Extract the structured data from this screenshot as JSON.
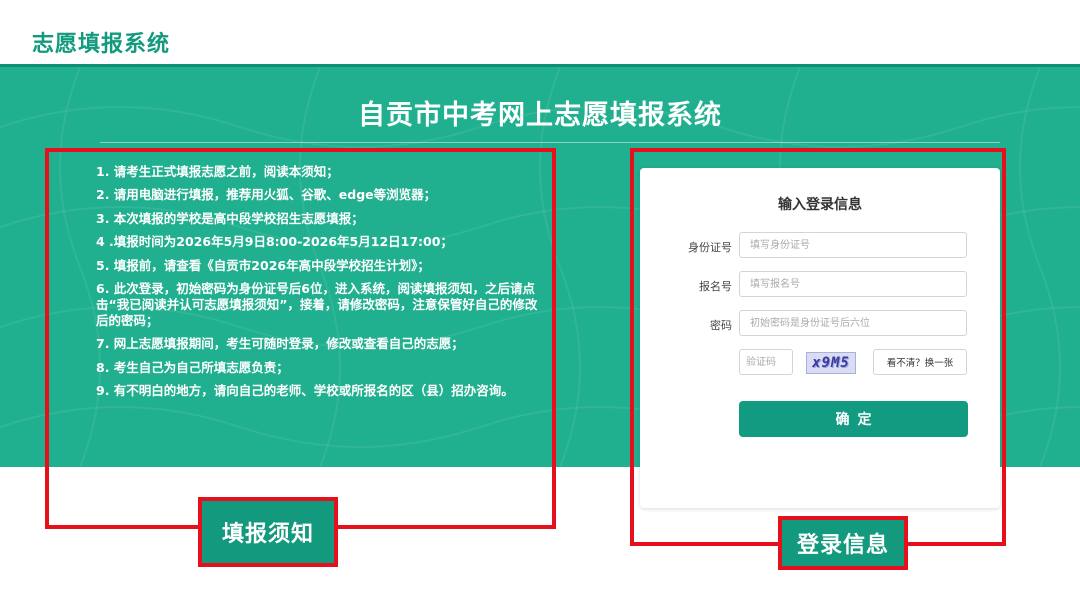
{
  "app_title": "志愿填报系统",
  "main_title": "自贡市中考网上志愿填报系统",
  "notice": [
    "1. 请考生正式填报志愿之前，阅读本须知；",
    "2. 请用电脑进行填报，推荐用火狐、谷歌、edge等浏览器；",
    "3. 本次填报的学校是高中段学校招生志愿填报；",
    "4 .填报时间为2026年5月9日8:00-2026年5月12日17:00；",
    "5. 填报前，请查看《自贡市2026年高中段学校招生计划》；",
    "6. 此次登录，初始密码为身份证号后6位，进入系统，阅读填报须知，之后请点击“我已阅读并认可志愿填报须知”，接着，请修改密码，注意保管好自己的修改后的密码；",
    "7. 网上志愿填报期间，考生可随时登录，修改或查看自己的志愿；",
    "8. 考生自己为自己所填志愿负责；",
    "9. 有不明白的地方，请向自己的老师、学校或所报名的区（县）招办咨询。"
  ],
  "login": {
    "heading": "输入登录信息",
    "id_label": "身份证号",
    "id_placeholder": "填写身份证号",
    "reg_label": "报名号",
    "reg_placeholder": "填写报名号",
    "password_label": "密码",
    "password_placeholder": "初始密码是身份证号后六位",
    "captcha_placeholder": "验证码",
    "captcha_text": "x9M5",
    "refresh_label": "看不清？换一张",
    "submit_label": "确定"
  },
  "annotations": {
    "notice_label": "填报须知",
    "login_label": "登录信息"
  },
  "colors": {
    "brand_green": "#21b08f",
    "button_green": "#139b82",
    "highlight_red": "#e5101b"
  }
}
